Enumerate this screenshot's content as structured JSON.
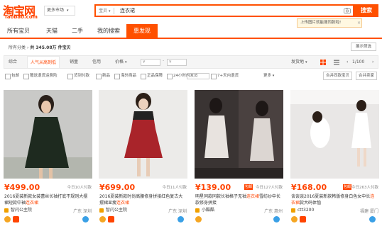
{
  "header": {
    "logo_zh": "淘宝网",
    "logo_en": "Taobao.com",
    "more_market": "更多市场",
    "search_category": "宝贝",
    "search_value": "连衣裙",
    "search_button": "搜索",
    "tip_text": "上传图片就能搜同款啦!",
    "tip_close": "×",
    "icons": [
      "camera-icon"
    ]
  },
  "tabs": [
    "所有宝贝",
    "天猫",
    "二手",
    "我的搜索",
    "惠发现"
  ],
  "breadcrumb": {
    "home": "所有分类",
    "result_text": "共 345.08万 件宝贝"
  },
  "show_filter": "展示筛选",
  "sortbar": {
    "items": [
      "综合",
      "人气从高到低",
      "销量",
      "信用",
      "价格"
    ],
    "price_min_placeholder": "¥",
    "price_max_placeholder": "¥",
    "ship_from": "发货地",
    "pager": "1/100"
  },
  "filters": {
    "checks": [
      "包邮",
      "赠送退货运费险",
      "货到付款",
      "新品",
      "海外商品",
      "正品保障",
      "24小时内发货",
      "7+天内退货"
    ],
    "more": "更多",
    "btn_same": "合并同款宝贝",
    "btn_shop": "合并卖家"
  },
  "items": [
    {
      "price": "¥499.00",
      "paid": "今日10人付款",
      "title_a": "2016夏装新款女装蕾丝长袖打底不规则",
      "title_b": "大摆裙短款中袖",
      "title_hl": "连衣裙",
      "shop": "智闪公主院",
      "location": "广东 深圳",
      "has_bao": false
    },
    {
      "price": "¥699.00",
      "paid": "今日11人付款",
      "title_a": "2016夏装新款时尚高腰修身拼接红色复",
      "title_b": "古大摆裙显瘦",
      "title_hl": "连衣裙",
      "shop": "智闪公主院",
      "location": "广东 深圳",
      "has_bao": false
    },
    {
      "price": "¥139.00",
      "paid": "今日127人付款",
      "title_a": "明星同款同款长袖格子无袖",
      "title_b": "雪纺纱中长款修身拼接",
      "title_hl": "连衣裙",
      "shop": "小酷酷",
      "location": "广东 惠州",
      "has_bao": true
    },
    {
      "price": "¥168.00",
      "paid": "今日263人付款",
      "title_a": "谈谈谈2016夏装新款韩版修身白色女中长",
      "title_b": "款大码体恤",
      "title_hl": "连衣裙",
      "shop": "ctt3200",
      "location": "福建 厦门",
      "has_bao": true
    }
  ],
  "colors": {
    "accent": "#ff5000",
    "price": "#ff4400"
  }
}
